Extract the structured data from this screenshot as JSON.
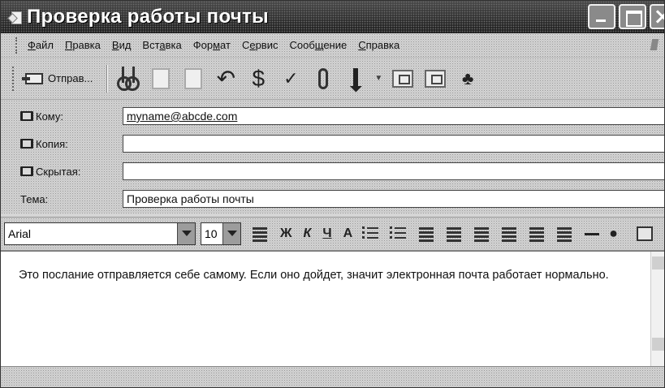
{
  "window": {
    "title": "Проверка работы почты"
  },
  "menu": {
    "items": [
      {
        "label": "Файл",
        "mnemonic": "Ф",
        "rest": "айл"
      },
      {
        "label": "Правка",
        "mnemonic": "П",
        "rest": "равка"
      },
      {
        "label": "Вид",
        "mnemonic": "В",
        "rest": "ид"
      },
      {
        "label": "Вставка",
        "pre": "Вст",
        "mnemonic": "а",
        "rest": "вка"
      },
      {
        "label": "Формат",
        "pre": "Фор",
        "mnemonic": "м",
        "rest": "ат"
      },
      {
        "label": "Сервис",
        "pre": "С",
        "mnemonic": "е",
        "rest": "рвис"
      },
      {
        "label": "Сообщение",
        "pre": "Сооб",
        "mnemonic": "щ",
        "rest": "ение"
      },
      {
        "label": "Справка",
        "mnemonic": "С",
        "rest": "правка"
      }
    ]
  },
  "toolbar": {
    "send_label": "Отправ...",
    "icons": [
      "send-icon",
      "cut-icon",
      "copy-icon",
      "paste-icon",
      "undo-icon",
      "check-names-icon",
      "spelling-icon",
      "attach-icon",
      "priority-icon",
      "sign-icon",
      "encrypt-icon",
      "offline-icon"
    ]
  },
  "fields": {
    "to_label": "Кому:",
    "to_value": "myname@abcde.com",
    "cc_label": "Копия:",
    "cc_value": "",
    "bcc_label": "Скрытая:",
    "bcc_value": "",
    "subject_label": "Тема:",
    "subject_value": "Проверка работы почты"
  },
  "format": {
    "font": "Arial",
    "size": "10",
    "bold": "Ж",
    "italic": "К",
    "underline": "Ч",
    "color": "A"
  },
  "body": {
    "text": "Это послание отправляется себе самому. Если оно дойдет, значит электронная почта работает нормально."
  }
}
